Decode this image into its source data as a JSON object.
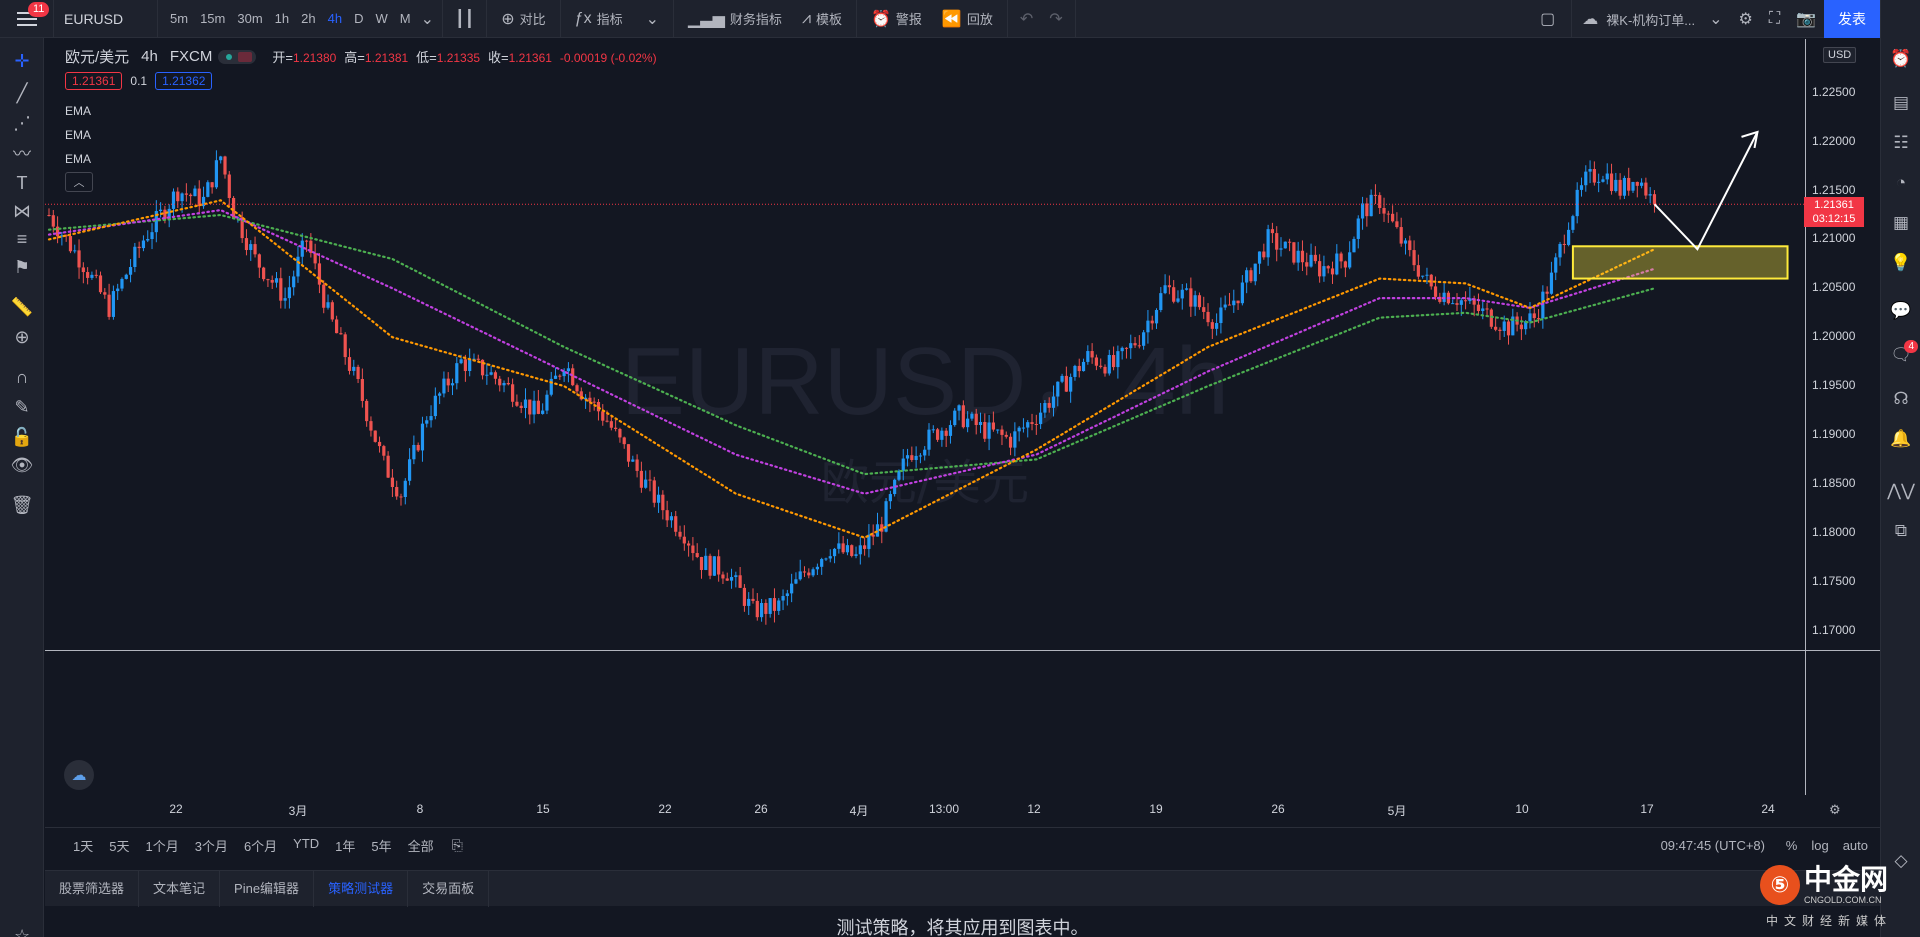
{
  "topbar": {
    "menu_badge": "11",
    "symbol": "EURUSD",
    "timeframes": [
      "5m",
      "15m",
      "30m",
      "1h",
      "2h",
      "4h",
      "D",
      "W",
      "M"
    ],
    "active_timeframe": "4h",
    "compare_label": "对比",
    "indicators_label": "指标",
    "financials_label": "财务指标",
    "templates_label": "模板",
    "alerts_label": "警报",
    "replay_label": "回放",
    "template_name": "裸K-机构订单...",
    "publish_label": "发表"
  },
  "legend": {
    "symbol_name": "欧元/美元",
    "interval": "4h",
    "source": "FXCM",
    "open_label": "开=",
    "open": "1.21380",
    "high_label": "高=",
    "high": "1.21381",
    "low_label": "低=",
    "low": "1.21335",
    "close_label": "收=",
    "close": "1.21361",
    "change": "-0.00019 (-0.02%)",
    "sell_price": "1.21361",
    "spread": "0.1",
    "buy_price": "1.21362",
    "ema_labels": [
      "EMA",
      "EMA",
      "EMA"
    ]
  },
  "watermark": {
    "main": "EURUSD，4h",
    "sub": "欧元/美元"
  },
  "price_axis": {
    "currency": "USD",
    "ticks": [
      "1.22500",
      "1.22000",
      "1.21500",
      "1.21000",
      "1.20500",
      "1.20000",
      "1.19500",
      "1.19000",
      "1.18500",
      "1.18000",
      "1.17500",
      "1.17000"
    ],
    "current_price": "1.21361",
    "countdown": "03:12:15"
  },
  "time_axis": {
    "ticks": [
      "22",
      "3月",
      "8",
      "15",
      "22",
      "26",
      "4月",
      "13:00",
      "12",
      "19",
      "26",
      "5月",
      "10",
      "17",
      "24"
    ]
  },
  "range_bar": {
    "ranges": [
      "1天",
      "5天",
      "1个月",
      "3个月",
      "6个月",
      "YTD",
      "1年",
      "5年",
      "全部"
    ],
    "clock": "09:47:45 (UTC+8)",
    "percent": "%",
    "log": "log",
    "auto": "auto"
  },
  "bottom_tabs": [
    "股票筛选器",
    "文本笔记",
    "Pine编辑器",
    "策略测试器",
    "交易面板"
  ],
  "active_bottom_tab": "策略测试器",
  "bottom_message": "测试策略，将其应用到图表中。",
  "branding": {
    "name": "中金网",
    "url": "CNGOLD.COM.CN",
    "tagline": "中文财经新媒体"
  },
  "right_badge": "4",
  "chart_data": {
    "type": "candlestick",
    "ylim": [
      1.1675,
      1.2305
    ],
    "colors": {
      "up": "#2196f3",
      "down": "#ef5350",
      "ema_fast": "#ff9800",
      "ema_mid": "#c040e0",
      "ema_slow": "#4caf50",
      "zone": "#ffeb3b",
      "arrow": "#ffffff"
    },
    "key_points": [
      [
        0,
        1.2125
      ],
      [
        8,
        1.2075
      ],
      [
        14,
        1.203
      ],
      [
        22,
        1.21
      ],
      [
        30,
        1.215
      ],
      [
        36,
        1.214
      ],
      [
        40,
        1.2185
      ],
      [
        43,
        1.213
      ],
      [
        48,
        1.208
      ],
      [
        55,
        1.204
      ],
      [
        60,
        1.21
      ],
      [
        65,
        1.2025
      ],
      [
        72,
        1.195
      ],
      [
        78,
        1.187
      ],
      [
        82,
        1.184
      ],
      [
        88,
        1.192
      ],
      [
        96,
        1.1975
      ],
      [
        102,
        1.1965
      ],
      [
        108,
        1.1945
      ],
      [
        114,
        1.192
      ],
      [
        120,
        1.1975
      ],
      [
        124,
        1.1945
      ],
      [
        130,
        1.1915
      ],
      [
        136,
        1.187
      ],
      [
        142,
        1.183
      ],
      [
        148,
        1.18
      ],
      [
        152,
        1.177
      ],
      [
        158,
        1.176
      ],
      [
        164,
        1.172
      ],
      [
        170,
        1.1725
      ],
      [
        176,
        1.176
      ],
      [
        182,
        1.1785
      ],
      [
        188,
        1.1775
      ],
      [
        194,
        1.181
      ],
      [
        200,
        1.188
      ],
      [
        206,
        1.19
      ],
      [
        212,
        1.192
      ],
      [
        218,
        1.1905
      ],
      [
        224,
        1.1895
      ],
      [
        230,
        1.192
      ],
      [
        236,
        1.195
      ],
      [
        242,
        1.198
      ],
      [
        248,
        1.197
      ],
      [
        254,
        1.2
      ],
      [
        260,
        1.205
      ],
      [
        266,
        1.204
      ],
      [
        272,
        1.2015
      ],
      [
        278,
        1.205
      ],
      [
        284,
        1.21
      ],
      [
        290,
        1.2085
      ],
      [
        296,
        1.207
      ],
      [
        302,
        1.208
      ],
      [
        306,
        1.213
      ],
      [
        310,
        1.214
      ],
      [
        316,
        1.209
      ],
      [
        322,
        1.205
      ],
      [
        328,
        1.204
      ],
      [
        334,
        1.2025
      ],
      [
        340,
        1.201
      ],
      [
        346,
        1.202
      ],
      [
        350,
        1.206
      ],
      [
        354,
        1.212
      ],
      [
        358,
        1.216
      ],
      [
        362,
        1.217
      ],
      [
        366,
        1.215
      ],
      [
        370,
        1.2165
      ],
      [
        374,
        1.2136
      ]
    ],
    "ema_fast": [
      [
        0,
        1.21
      ],
      [
        40,
        1.214
      ],
      [
        80,
        1.2
      ],
      [
        120,
        1.195
      ],
      [
        160,
        1.184
      ],
      [
        190,
        1.1795
      ],
      [
        230,
        1.1885
      ],
      [
        270,
        1.199
      ],
      [
        310,
        1.206
      ],
      [
        330,
        1.2055
      ],
      [
        345,
        1.203
      ],
      [
        374,
        1.209
      ]
    ],
    "ema_mid": [
      [
        0,
        1.2105
      ],
      [
        40,
        1.213
      ],
      [
        80,
        1.205
      ],
      [
        120,
        1.1965
      ],
      [
        160,
        1.188
      ],
      [
        190,
        1.184
      ],
      [
        230,
        1.188
      ],
      [
        270,
        1.1965
      ],
      [
        310,
        1.204
      ],
      [
        330,
        1.204
      ],
      [
        345,
        1.203
      ],
      [
        374,
        1.207
      ]
    ],
    "ema_slow": [
      [
        0,
        1.211
      ],
      [
        40,
        1.2125
      ],
      [
        80,
        1.208
      ],
      [
        120,
        1.199
      ],
      [
        160,
        1.191
      ],
      [
        190,
        1.186
      ],
      [
        230,
        1.1875
      ],
      [
        270,
        1.195
      ],
      [
        310,
        1.202
      ],
      [
        330,
        1.2025
      ],
      [
        345,
        1.2015
      ],
      [
        374,
        1.205
      ]
    ],
    "zone": {
      "x_from": 355,
      "x_to": 405,
      "y_low": 1.206,
      "y_high": 1.2093
    },
    "arrow": [
      [
        374,
        1.2136
      ],
      [
        384,
        1.209
      ],
      [
        398,
        1.221
      ]
    ]
  }
}
